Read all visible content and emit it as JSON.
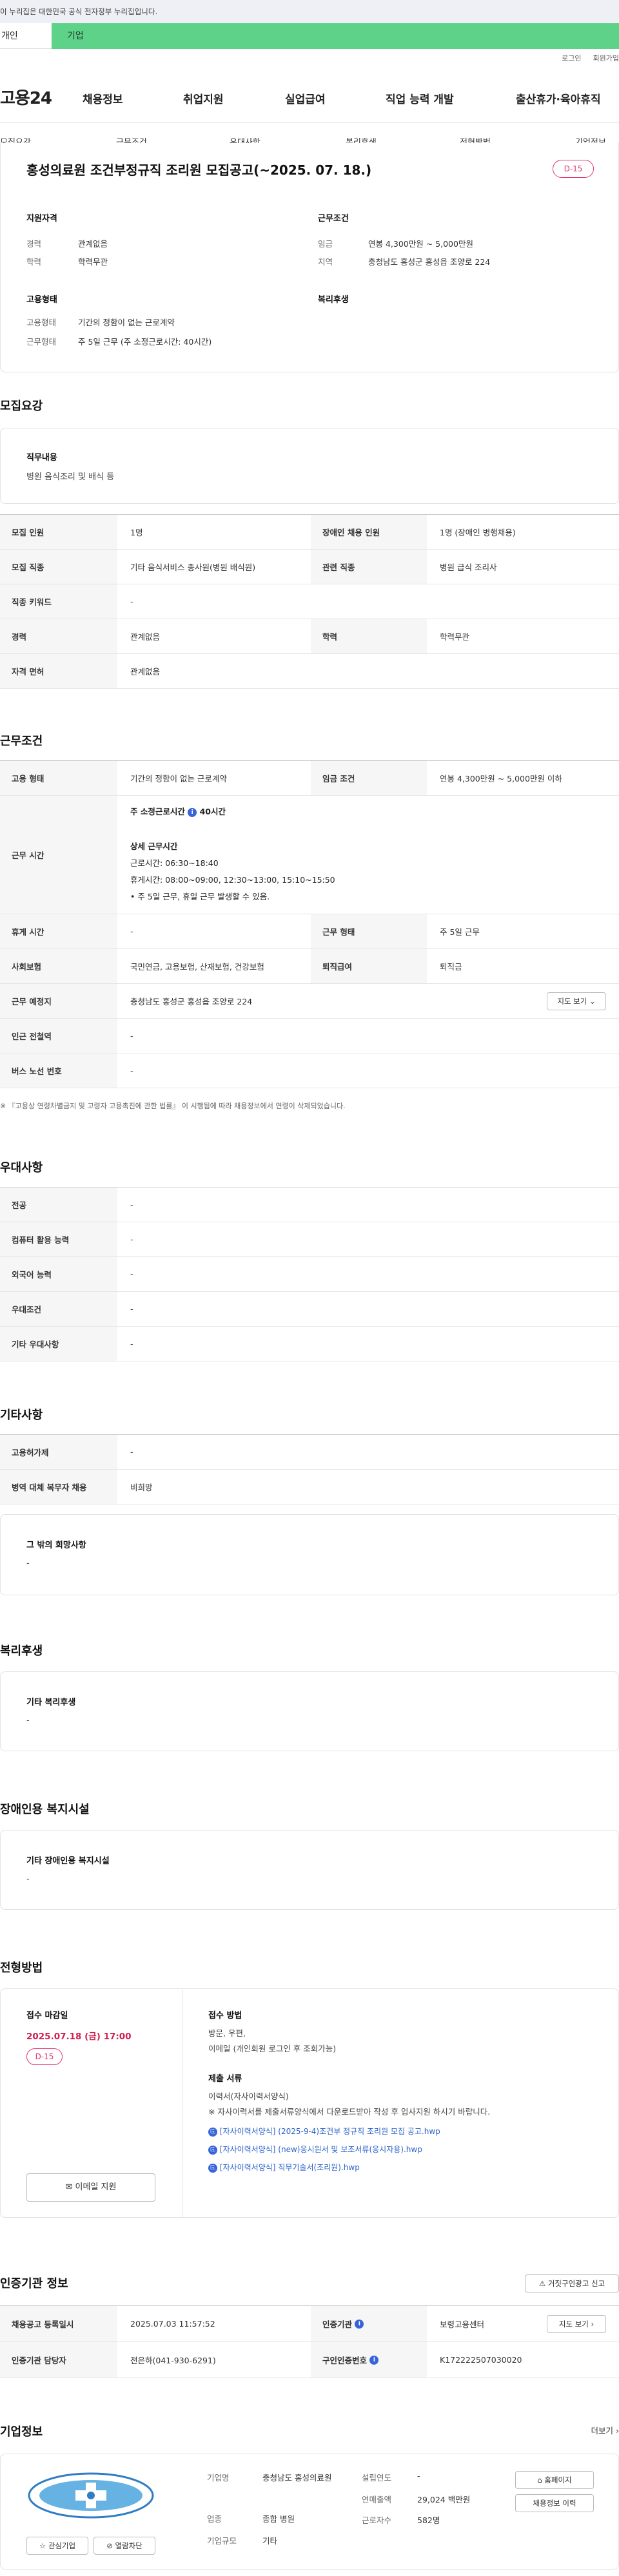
{
  "gov_banner": "이 누리집은 대한민국 공식 전자정부 누리집입니다.",
  "tabs": {
    "individual": "개인",
    "business": "기업"
  },
  "util": {
    "login": "로그인",
    "signup": "회원가입"
  },
  "logo": "고용24",
  "gnb": [
    "채용정보",
    "취업지원",
    "실업급여",
    "직업 능력 개발",
    "출산휴가·육아휴직"
  ],
  "subnav": [
    "모집요강",
    "근무조건",
    "우대사항",
    "복리후생",
    "전형방법",
    "기업정보"
  ],
  "job": {
    "title": "홍성의료원 조건부정규직 조리원 모집공고(~2025. 07. 18.)",
    "dday": "D-15"
  },
  "summary": {
    "qual_heading": "지원자격",
    "cond_heading": "근무조건",
    "emp_heading": "고용형태",
    "welfare_heading": "복리후생",
    "career_k": "경력",
    "career_v": "관계없음",
    "edu_k": "학력",
    "edu_v": "학력무관",
    "wage_k": "임금",
    "wage_v": "연봉 4,300만원 ~ 5,000만원",
    "region_k": "지역",
    "region_v": "충청남도 홍성군 홍성읍 조양로 224",
    "emptype_k": "고용형태",
    "emptype_v": "기간의 정함이 없는 근로계약",
    "worktype_k": "근무형태",
    "worktype_v": "주 5일 근무 (주 소정근로시간: 40시간)"
  },
  "recruit": {
    "heading": "모집요강",
    "duty_title": "직무내용",
    "duty_text": "병원 음식조리 및 배식 등",
    "rows": [
      [
        "모집 인원",
        "1명",
        "장애인 채용 인원",
        "1명 (장애인 병행채용)"
      ],
      [
        "모집 직종",
        "기타 음식서비스 종사원(병원 배식원)",
        "관련 직종",
        "병원 급식 조리사"
      ],
      [
        "직종 키워드",
        "-"
      ],
      [
        "경력",
        "관계없음",
        "학력",
        "학력무관"
      ],
      [
        "자격 면허",
        "관계없음"
      ]
    ]
  },
  "conditions": {
    "heading": "근무조건",
    "emptype_k": "고용 형태",
    "emptype_v": "기간의 정함이 없는 근로계약",
    "wage_k": "임금 조건",
    "wage_v": "연봉 4,300만원 ~ 5,000만원 이하",
    "hours_k": "근무 시간",
    "hours_weekly": "주 소정근로시간",
    "hours_weekly_val": "40시간",
    "hours_detail_title": "상세 근무시간",
    "hours_work": "근로시간: 06:30~18:40",
    "hours_rest": "휴게시간: 08:00~09:00, 12:30~13:00, 15:10~15:50",
    "hours_note": "• 주 5일 근무, 휴일 근무 발생할 수 있음.",
    "break_k": "휴게 시간",
    "break_v": "-",
    "worktype_k": "근무 형태",
    "worktype_v": "주 5일 근무",
    "insurance_k": "사회보험",
    "insurance_v": "국민연금, 고용보험, 산재보험, 건강보험",
    "severance_k": "퇴직급여",
    "severance_v": "퇴직금",
    "place_k": "근무 예정지",
    "place_v": "충청남도 홍성군 홍성읍 조양로 224",
    "map_btn": "지도 보기",
    "subway_k": "인근 전철역",
    "subway_v": "-",
    "bus_k": "버스 노선 번호",
    "bus_v": "-",
    "note": "※ 『고용상 연령차별금지 및 고령자 고용촉진에 관한 법률』 이 시행됨에 따라 채용정보에서 연령이 삭제되었습니다."
  },
  "preference": {
    "heading": "우대사항",
    "rows": [
      [
        "전공",
        "-"
      ],
      [
        "컴퓨터 활용 능력",
        "-"
      ],
      [
        "외국어 능력",
        "-"
      ],
      [
        "우대조건",
        "-"
      ],
      [
        "기타 우대사항",
        "-"
      ]
    ]
  },
  "etc": {
    "heading": "기타사항",
    "rows": [
      [
        "고용허가제",
        "-"
      ],
      [
        "병역 대체 복무자 채용",
        "비희망"
      ]
    ],
    "other_title": "그 밖의 희망사항",
    "other_text": "-"
  },
  "welfare": {
    "heading": "복리후생",
    "title": "기타 복리후생",
    "text": "-"
  },
  "disabled": {
    "heading": "장애인용 복지시설",
    "title": "기타 장애인용 복지시설",
    "text": "-"
  },
  "screening": {
    "heading": "전형방법",
    "deadline_label": "접수 마감일",
    "deadline": "2025.07.18 (금) 17:00",
    "dday": "D-15",
    "email_btn": "이메일 지원",
    "method_title": "접수 방법",
    "method_line1": "방문, 우편,",
    "method_line2": "이메일 (개인회원 로그인 후 조회가능)",
    "docs_title": "제출 서류",
    "docs_line1": "이력서(자사이력서양식)",
    "docs_line2": "※ 자사이력서를 제출서류양식에서 다운로드받아 작성 후 입사지원 하시기 바랍니다.",
    "files": [
      "[자사이력서양식] (2025-9-4)조건부 정규직 조리원 모집 공고.hwp",
      "[자사이력서양식] (new)응시원서 및 보조서류(응시자용).hwp",
      "[자사이력서양식] 직무기술서(조리원).hwp"
    ]
  },
  "agency": {
    "heading": "인증기관 정보",
    "report_btn": "거짓구인광고 신고",
    "reg_k": "채용공고 등록일시",
    "reg_v": "2025.07.03 11:57:52",
    "inst_k": "인증기관",
    "inst_v": "보령고용센터",
    "map_btn": "지도 보기",
    "mgr_k": "인증기관 담당자",
    "mgr_v": "전은하(041-930-6291)",
    "num_k": "구인인증번호",
    "num_v": "K172222507030020"
  },
  "company": {
    "heading": "기업정보",
    "more": "더보기",
    "fav_btn": "관심기업",
    "block_btn": "열람차단",
    "name_k": "기업명",
    "name_v": "충청남도 홍성의료원",
    "industry_k": "업종",
    "industry_v": "종합 병원",
    "scale_k": "기업규모",
    "scale_v": "기타",
    "founded_k": "설립연도",
    "founded_v": "-",
    "sales_k": "연매출액",
    "sales_v": "29,024 백만원",
    "staff_k": "근로자수",
    "staff_v": "582명",
    "homepage_btn": "홈페이지",
    "hist_btn": "채용정보 이력"
  }
}
